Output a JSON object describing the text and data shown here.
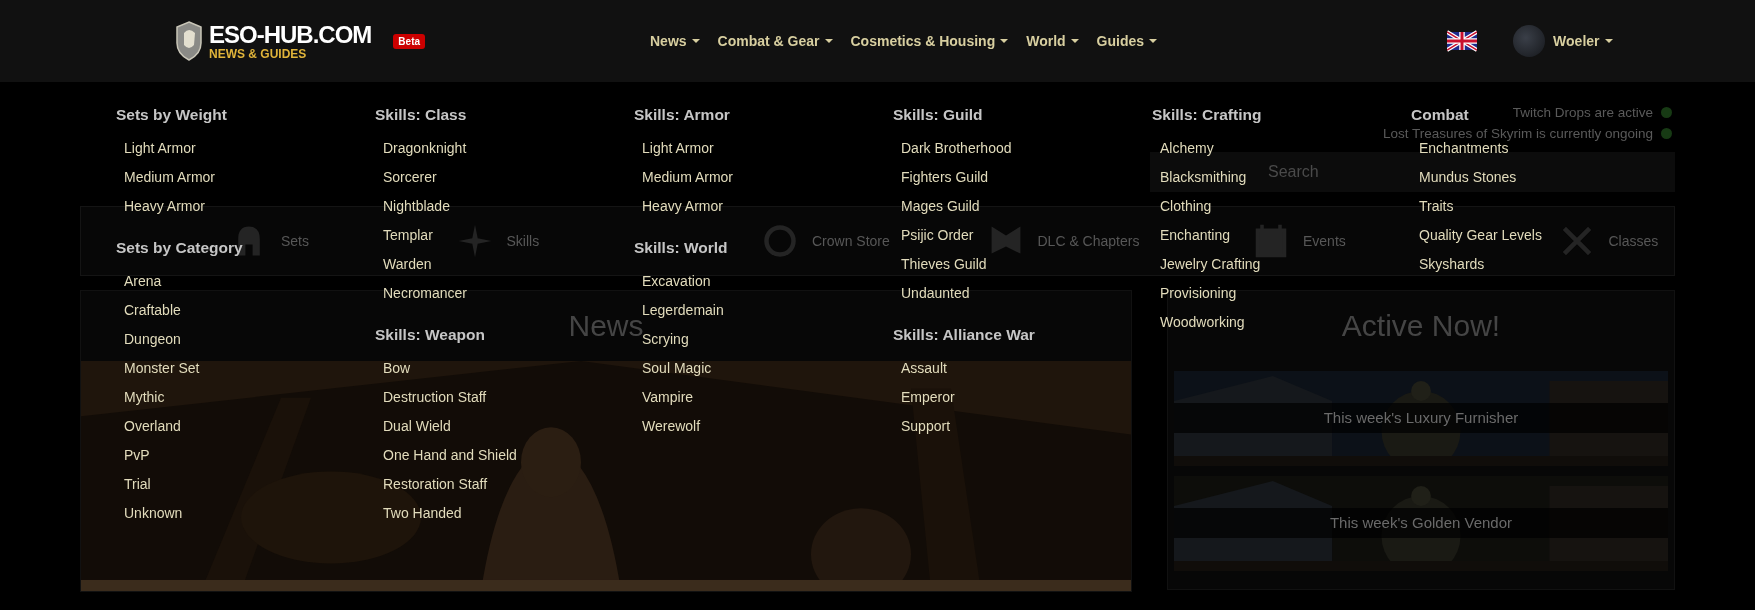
{
  "header": {
    "logo": {
      "title": "ESO-HUB.COM",
      "subtitle": "NEWS & GUIDES",
      "badge": "Beta"
    },
    "nav": [
      {
        "label": "News"
      },
      {
        "label": "Combat & Gear"
      },
      {
        "label": "Cosmetics & Housing"
      },
      {
        "label": "World"
      },
      {
        "label": "Guides"
      }
    ],
    "user": {
      "name": "Woeler"
    }
  },
  "mega_menu": {
    "columns": [
      {
        "groups": [
          {
            "heading": "Sets by Weight",
            "items": [
              "Light Armor",
              "Medium Armor",
              "Heavy Armor"
            ]
          },
          {
            "heading": "Sets by Category",
            "items": [
              "Arena",
              "Craftable",
              "Dungeon",
              "Monster Set",
              "Mythic",
              "Overland",
              "PvP",
              "Trial",
              "Unknown"
            ]
          }
        ]
      },
      {
        "groups": [
          {
            "heading": "Skills: Class",
            "items": [
              "Dragonknight",
              "Sorcerer",
              "Nightblade",
              "Templar",
              "Warden",
              "Necromancer"
            ]
          },
          {
            "heading": "Skills: Weapon",
            "items": [
              "Bow",
              "Destruction Staff",
              "Dual Wield",
              "One Hand and Shield",
              "Restoration Staff",
              "Two Handed"
            ]
          }
        ]
      },
      {
        "groups": [
          {
            "heading": "Skills: Armor",
            "items": [
              "Light Armor",
              "Medium Armor",
              "Heavy Armor"
            ]
          },
          {
            "heading": "Skills: World",
            "items": [
              "Excavation",
              "Legerdemain",
              "Scrying",
              "Soul Magic",
              "Vampire",
              "Werewolf"
            ]
          }
        ]
      },
      {
        "groups": [
          {
            "heading": "Skills: Guild",
            "items": [
              "Dark Brotherhood",
              "Fighters Guild",
              "Mages Guild",
              "Psijic Order",
              "Thieves Guild",
              "Undaunted"
            ]
          },
          {
            "heading": "Skills: Alliance War",
            "items": [
              "Assault",
              "Emperor",
              "Support"
            ]
          }
        ]
      },
      {
        "groups": [
          {
            "heading": "Skills: Crafting",
            "items": [
              "Alchemy",
              "Blacksmithing",
              "Clothing",
              "Enchanting",
              "Jewelry Crafting",
              "Provisioning",
              "Woodworking"
            ]
          }
        ]
      },
      {
        "groups": [
          {
            "heading": "Combat",
            "items": [
              "Enchantments",
              "Mundus Stones",
              "Traits",
              "Quality Gear Levels",
              "Skyshards"
            ]
          }
        ]
      }
    ]
  },
  "page": {
    "status": [
      "Twitch Drops are active",
      "Lost Treasures of Skyrim is currently ongoing"
    ],
    "search": {
      "placeholder": "Search"
    },
    "tiles": [
      {
        "label": "Sets"
      },
      {
        "label": "Skills"
      },
      {
        "label": "Crown Store"
      },
      {
        "label": "DLC & Chapters"
      },
      {
        "label": "Events"
      },
      {
        "label": "Classes"
      }
    ],
    "news": {
      "title": "News"
    },
    "active_now": {
      "title": "Active Now!",
      "cards": [
        {
          "caption": "This week's Luxury Furnisher"
        },
        {
          "caption": "This week's Golden Vendor"
        }
      ]
    }
  }
}
